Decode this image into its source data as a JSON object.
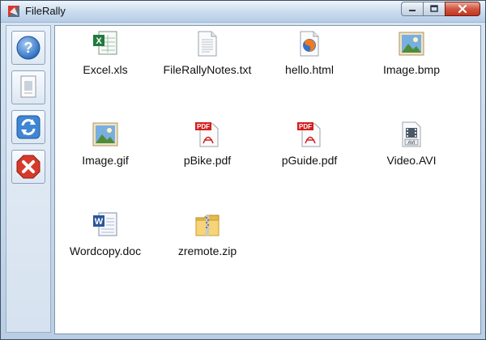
{
  "window": {
    "title": "FileRally"
  },
  "sidebar": {
    "tools": [
      {
        "icon": "help-icon"
      },
      {
        "icon": "document-preview-icon"
      },
      {
        "icon": "refresh-icon"
      },
      {
        "icon": "close-x-icon"
      }
    ]
  },
  "files": [
    {
      "name": "Excel.xls",
      "icon": "excel-file-icon"
    },
    {
      "name": "FileRallyNotes.txt",
      "icon": "text-file-icon"
    },
    {
      "name": "hello.html",
      "icon": "html-file-icon"
    },
    {
      "name": "Image.bmp",
      "icon": "image-file-icon"
    },
    {
      "name": "Image.gif",
      "icon": "image-file-icon"
    },
    {
      "name": "pBike.pdf",
      "icon": "pdf-file-icon"
    },
    {
      "name": "pGuide.pdf",
      "icon": "pdf-file-icon"
    },
    {
      "name": "Video.AVI",
      "icon": "video-file-icon"
    },
    {
      "name": "Wordcopy.doc",
      "icon": "word-file-icon"
    },
    {
      "name": "zremote.zip",
      "icon": "zip-folder-icon"
    }
  ],
  "colors": {
    "pdf_red": "#d31f1f",
    "excel_green": "#1f7a3e",
    "word_blue": "#2b579a",
    "close_red": "#c1361f"
  }
}
